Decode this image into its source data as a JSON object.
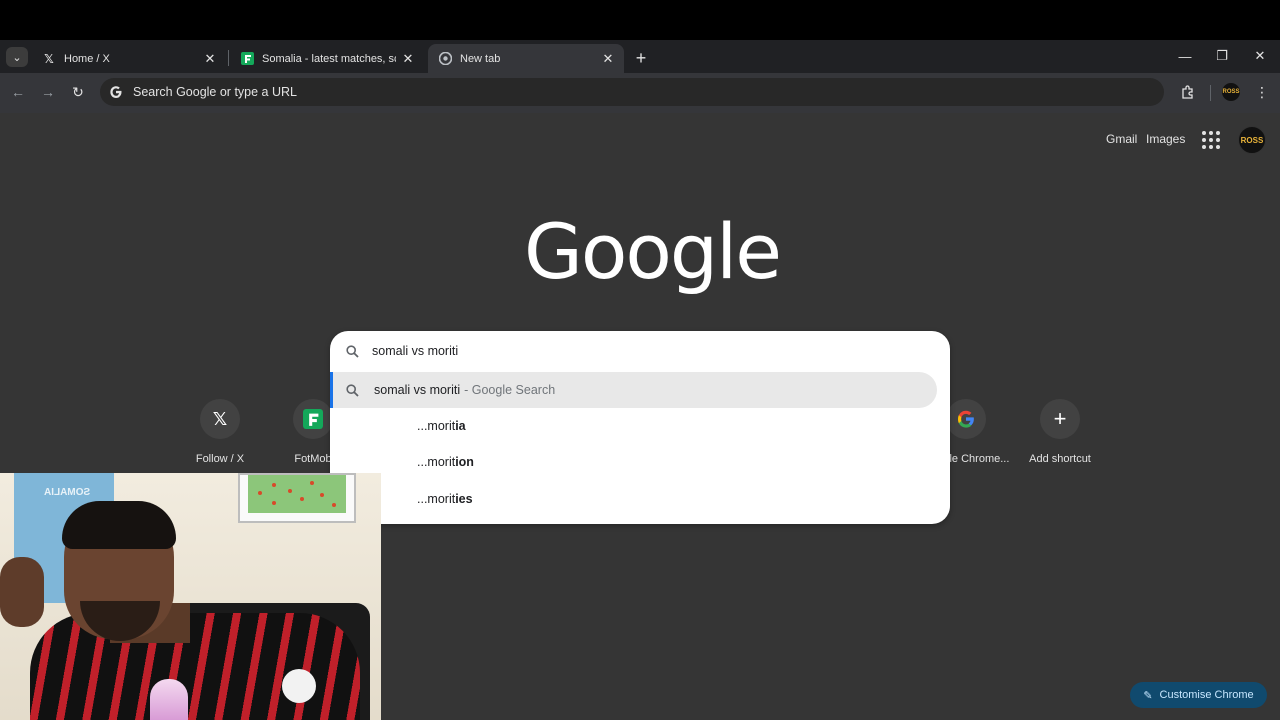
{
  "tabs": [
    {
      "title": "Home / X",
      "favicon": "x-logo-icon",
      "active": false
    },
    {
      "title": "Somalia - latest matches, scores",
      "favicon": "fotmob-icon",
      "active": false
    },
    {
      "title": "New tab",
      "favicon": "chrome-icon",
      "active": true
    }
  ],
  "toolbar": {
    "omnibox_placeholder": "Search Google or type a URL"
  },
  "header_links": {
    "gmail": "Gmail",
    "images": "Images",
    "avatar_text": "ROSS"
  },
  "logo_text": "Google",
  "search": {
    "query": "somali vs moriti",
    "highlighted": {
      "query": "somali vs moriti",
      "source": "- Google Search"
    },
    "suggestions": [
      {
        "prefix": "... ",
        "typed": "morit",
        "completion": "ia"
      },
      {
        "prefix": "... ",
        "typed": "morit",
        "completion": "ion"
      },
      {
        "prefix": "... ",
        "typed": "morit",
        "completion": "ies"
      }
    ]
  },
  "shortcuts": [
    {
      "label": "Follow / X",
      "icon": "x-logo-icon"
    },
    {
      "label": "FotMob",
      "icon": "fotmob-icon"
    },
    {
      "label": "Google Chrome...",
      "icon": "google-g-icon"
    },
    {
      "label": "Add shortcut",
      "icon": "plus-icon"
    }
  ],
  "customise_label": "Customise Chrome",
  "webcam": {
    "jersey_text": "SOMALIA"
  },
  "colors": {
    "tab_strip": "#202124",
    "toolbar": "#35363a",
    "page_bg": "#353535",
    "accent_blue": "#1a73e8",
    "customise_bg": "#104a6e"
  }
}
